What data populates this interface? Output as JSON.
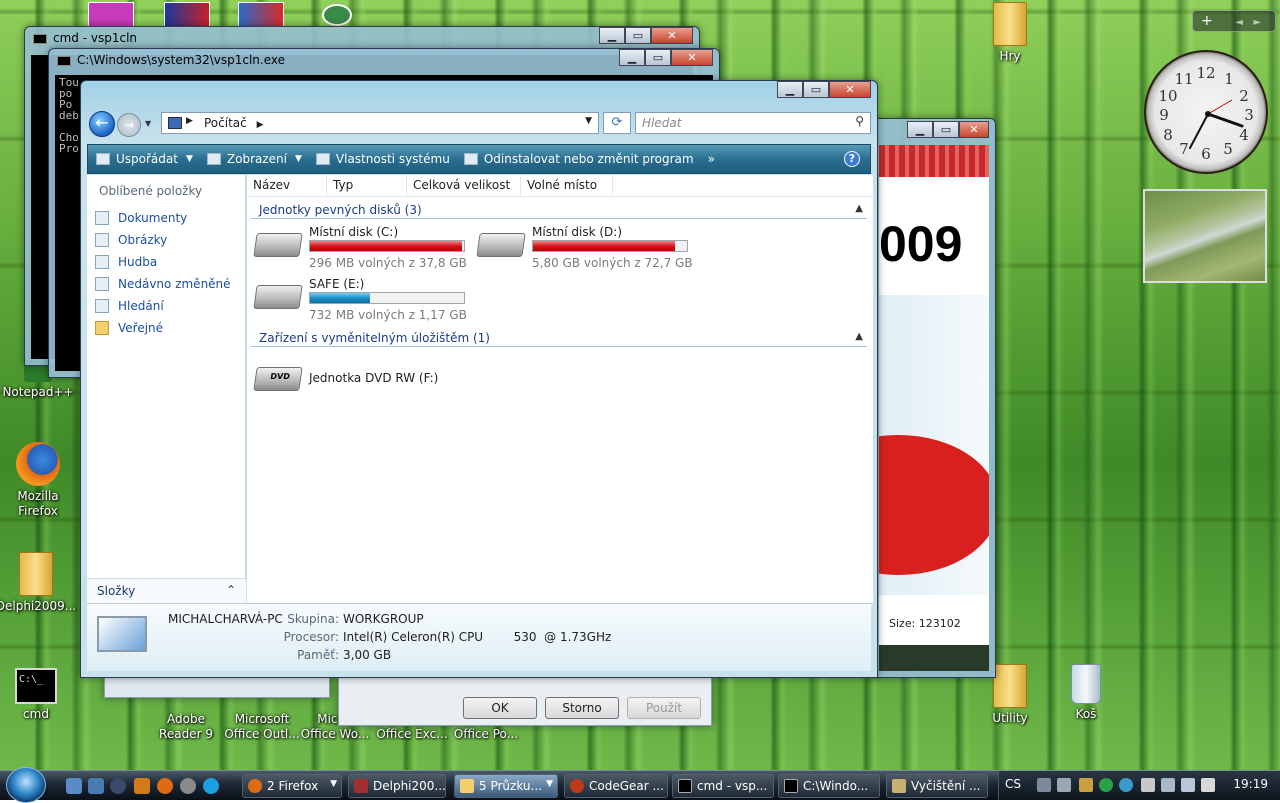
{
  "desktop": {
    "icons": [
      {
        "label": "Notepad++"
      },
      {
        "label": "Mozilla Firefox"
      },
      {
        "label": "Delphi2009..."
      },
      {
        "label": "cmd"
      },
      {
        "label": "Adobe Reader 9"
      },
      {
        "label": "Microsoft Office Outl..."
      },
      {
        "label": "Micr... Office Wo..."
      },
      {
        "label": "Office Exc..."
      },
      {
        "label": "Office Po..."
      },
      {
        "label": "Hry"
      },
      {
        "label": "Utility"
      },
      {
        "label": "Koš"
      }
    ]
  },
  "gadgets": {
    "toolbar_plus": "+",
    "clock_numbers": [
      "12",
      "1",
      "2",
      "3",
      "4",
      "5",
      "6",
      "7",
      "8",
      "9",
      "10",
      "11"
    ]
  },
  "windows": {
    "cmd1_title": "cmd - vsp1cln",
    "cmd2_title": "C:\\Windows\\system32\\vsp1cln.exe",
    "cmd2_text": [
      "Tou",
      " po",
      "Po",
      "deb",
      "",
      "Cho",
      "Pro"
    ],
    "right_win_text": {
      "headline": "009",
      "size_label": "Size: 123102"
    },
    "dialog": {
      "ok": "OK",
      "cancel": "Storno",
      "apply": "Použít"
    }
  },
  "explorer": {
    "address": {
      "location": "Počítač"
    },
    "search": {
      "placeholder": "Hledat"
    },
    "commands": [
      {
        "label": "Uspořádat",
        "dropdown": true
      },
      {
        "label": "Zobrazení",
        "dropdown": true
      },
      {
        "label": "Vlastnosti systému",
        "dropdown": false
      },
      {
        "label": "Odinstalovat nebo změnit program",
        "dropdown": false
      }
    ],
    "more": "»",
    "help": "?",
    "nav": {
      "header": "Oblíbené položky",
      "items": [
        {
          "label": "Dokumenty"
        },
        {
          "label": "Obrázky"
        },
        {
          "label": "Hudba"
        },
        {
          "label": "Nedávno změněné"
        },
        {
          "label": "Hledání"
        },
        {
          "label": "Veřejné"
        }
      ],
      "folders_label": "Složky"
    },
    "columns": [
      "Název",
      "Typ",
      "Celková velikost",
      "Volné místo"
    ],
    "groups": [
      {
        "title": "Jednotky pevných disků (3)",
        "drives": [
          {
            "name": "Místní disk (C:)",
            "free": "296 MB volných z 37,8 GB",
            "used_fraction": 0.99,
            "color": "#d8141c"
          },
          {
            "name": "Místní disk (D:)",
            "free": "5,80 GB volných z 72,7 GB",
            "used_fraction": 0.92,
            "color": "#d8141c"
          },
          {
            "name": "SAFE (E:)",
            "free": "732 MB volných z 1,17 GB",
            "used_fraction": 0.39,
            "color": "#1a8fc8"
          }
        ]
      },
      {
        "title": "Zařízení s vyměnitelným úložištěm (1)",
        "drives": [
          {
            "name": "Jednotka DVD RW (F:)",
            "badge": "DVD"
          }
        ]
      }
    ],
    "details": {
      "computer_name": "MICHALCHARVÁ-PC",
      "group_label": "Skupina:",
      "group_value": "WORKGROUP",
      "cpu_label": "Procesor:",
      "cpu_value": "Intel(R) Celeron(R) CPU        530  @ 1.73GHz",
      "mem_label": "Paměť:",
      "mem_value": "3,00 GB"
    }
  },
  "taskbar": {
    "tasks": [
      {
        "label": "2 Firefox",
        "dropdown": true
      },
      {
        "label": "Delphi200...",
        "dropdown": false
      },
      {
        "label": "5 Průzku...",
        "dropdown": true,
        "active": true
      },
      {
        "label": "CodeGear ...",
        "dropdown": false
      },
      {
        "label": "cmd - vsp...",
        "dropdown": false
      },
      {
        "label": "C:\\Windo...",
        "dropdown": false
      },
      {
        "label": "Vyčištění ...",
        "dropdown": false
      }
    ],
    "language": "CS",
    "time": "19:19"
  }
}
